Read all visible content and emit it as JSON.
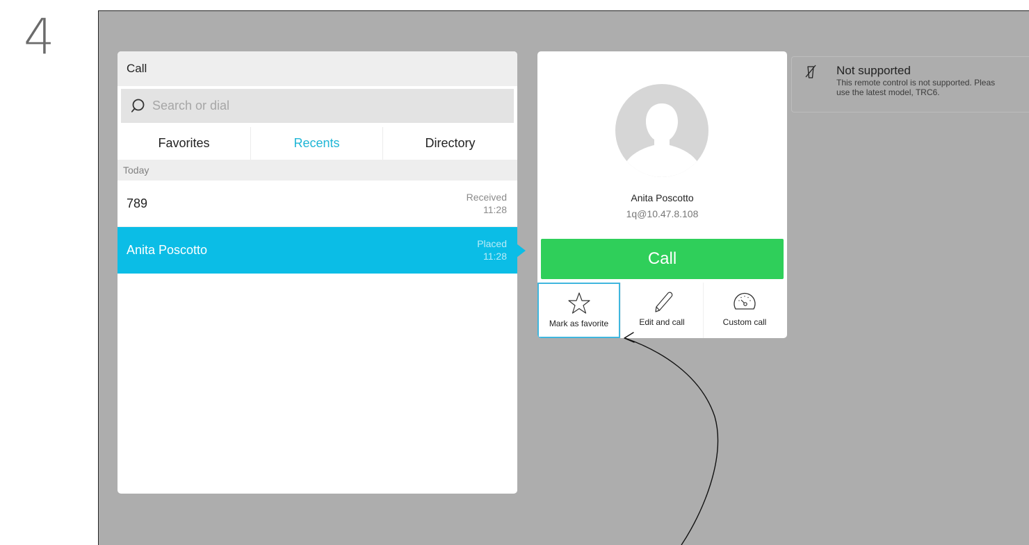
{
  "step_number": "4",
  "call_panel": {
    "title": "Call",
    "search": {
      "placeholder": "Search or dial",
      "value": ""
    },
    "tabs": [
      {
        "label": "Favorites",
        "active": false
      },
      {
        "label": "Recents",
        "active": true
      },
      {
        "label": "Directory",
        "active": false
      }
    ],
    "section": "Today",
    "recents": [
      {
        "name": "789",
        "status": "Received",
        "time": "11:28",
        "selected": false
      },
      {
        "name": "Anita Poscotto",
        "status": "Placed",
        "time": "11:28",
        "selected": true
      }
    ]
  },
  "contact_card": {
    "name": "Anita Poscotto",
    "uri": "1q@10.47.8.108",
    "call_label": "Call",
    "actions": [
      {
        "label": "Mark as favorite",
        "icon": "star-icon",
        "selected": true
      },
      {
        "label": "Edit and call",
        "icon": "pencil-icon",
        "selected": false
      },
      {
        "label": "Custom call",
        "icon": "gauge-icon",
        "selected": false
      }
    ]
  },
  "notification": {
    "title": "Not supported",
    "line1": "This remote control is not supported. Pleas",
    "line2": "use the latest model, TRC6.",
    "icon": "remote-control-crossed-icon"
  },
  "colors": {
    "accent": "#0bbde6",
    "call_green": "#2fcf5a",
    "screen_bg": "#adadad",
    "active_tab": "#1fb6d6"
  }
}
